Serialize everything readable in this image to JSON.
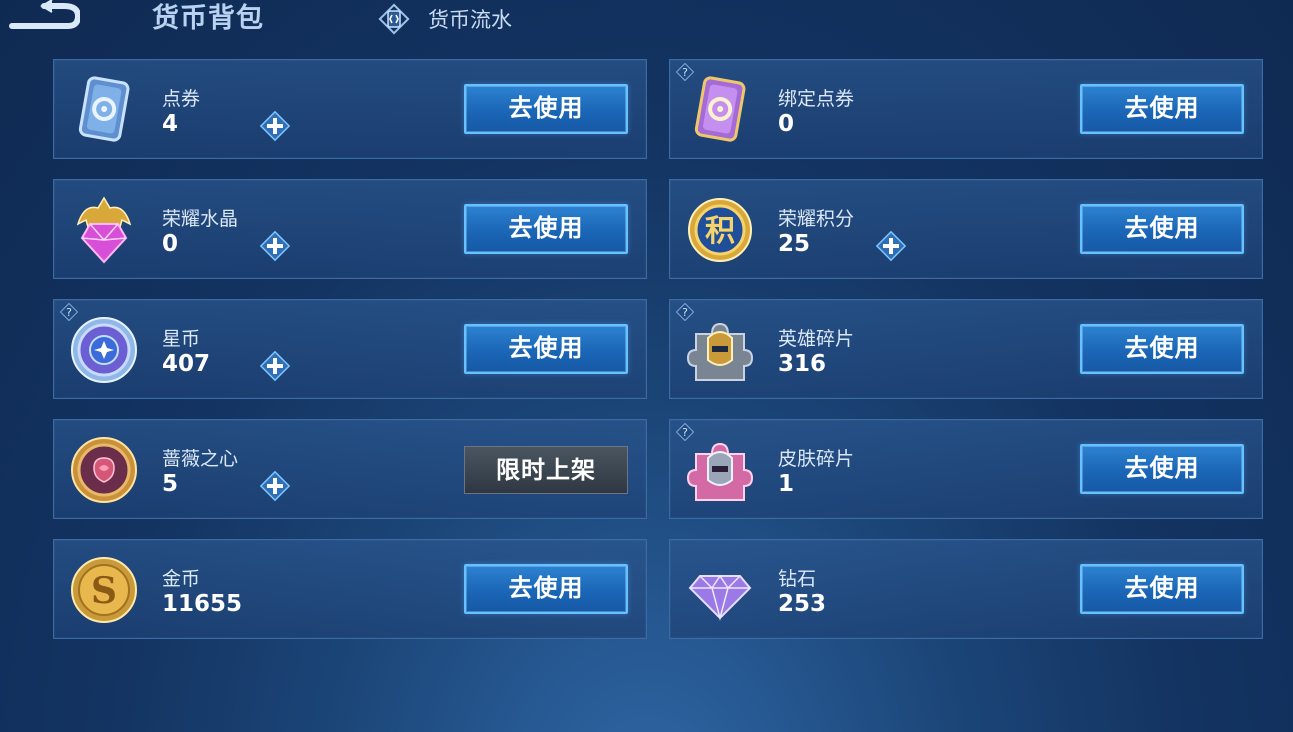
{
  "header": {
    "title": "货币背包",
    "flow_label": "货币流水"
  },
  "items": [
    {
      "name": "点券",
      "count": "4",
      "button": "去使用",
      "icon": "ticket-blue-icon"
    },
    {
      "name": "绑定点券",
      "count": "0",
      "button": "去使用",
      "icon": "ticket-purple-icon"
    },
    {
      "name": "荣耀水晶",
      "count": "0",
      "button": "去使用",
      "icon": "crystal-icon"
    },
    {
      "name": "荣耀积分",
      "count": "25",
      "button": "去使用",
      "icon": "points-coin-icon",
      "icon_char": "积"
    },
    {
      "name": "星币",
      "count": "407",
      "button": "去使用",
      "icon": "star-coin-icon"
    },
    {
      "name": "英雄碎片",
      "count": "316",
      "button": "去使用",
      "icon": "hero-fragment-icon"
    },
    {
      "name": "蔷薇之心",
      "count": "5",
      "button": "限时上架",
      "icon": "rose-heart-icon"
    },
    {
      "name": "皮肤碎片",
      "count": "1",
      "button": "去使用",
      "icon": "skin-fragment-icon"
    },
    {
      "name": "金币",
      "count": "11655",
      "button": "去使用",
      "icon": "gold-coin-icon",
      "icon_char": "S"
    },
    {
      "name": "钻石",
      "count": "253",
      "button": "去使用",
      "icon": "diamond-icon"
    }
  ]
}
